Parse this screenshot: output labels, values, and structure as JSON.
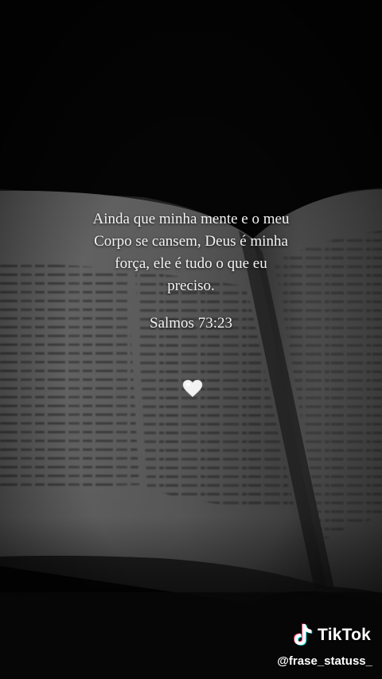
{
  "quote": {
    "lines": [
      "Ainda que minha mente e o meu",
      "Corpo se cansem, Deus é minha",
      "força, ele é tudo o que eu",
      "preciso."
    ],
    "reference": "Salmos 73:23",
    "heart_emoji": "white-heart"
  },
  "watermark": {
    "brand": "TikTok",
    "icon": "tiktok-note-icon",
    "username": "@frase_statuss_"
  },
  "colors": {
    "background": "#050505",
    "text": "#f4f4f4"
  }
}
